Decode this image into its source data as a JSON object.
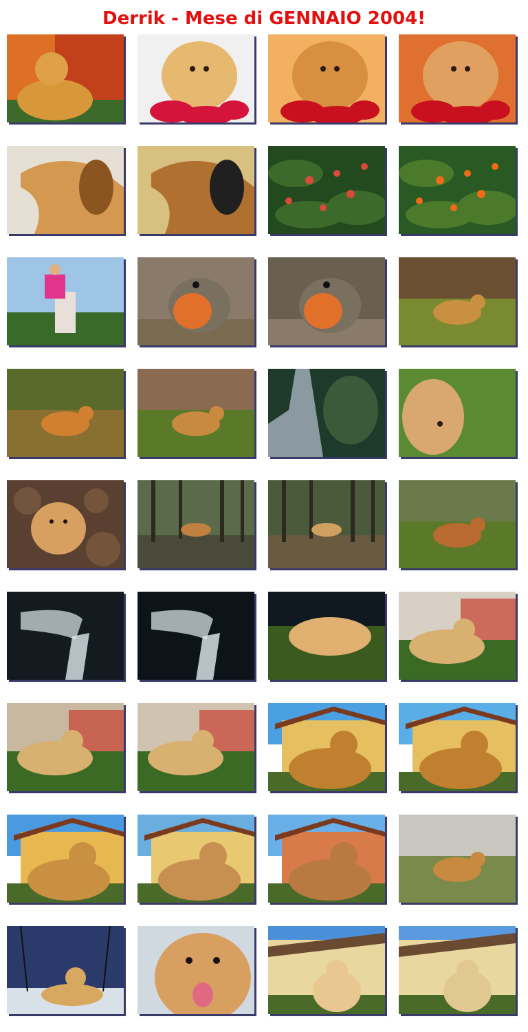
{
  "page": {
    "title": "Derrik - Mese di GENNAIO 2004!"
  },
  "thumbnails": [
    {
      "name": "dog-on-green-mat-photo",
      "scene": "dog-indoor",
      "c1": "#e8842a",
      "c2": "#c2401a",
      "c3": "#3c6a2a"
    },
    {
      "name": "dog-with-poinsettia-photo",
      "scene": "dog-flowers-light",
      "c1": "#f0f0f0",
      "c2": "#e6b870",
      "c3": "#d4143a"
    },
    {
      "name": "dog-sniffing-poinsettia-photo",
      "scene": "dog-flowers",
      "c1": "#f2b060",
      "c2": "#d89040",
      "c3": "#c8101e"
    },
    {
      "name": "dog-behind-poinsettia-pot-photo",
      "scene": "dog-flowers",
      "c1": "#e07030",
      "c2": "#e0a060",
      "c3": "#c8101e"
    },
    {
      "name": "dog-profile-closeup-photo",
      "scene": "dog-profile",
      "c1": "#e6e0d4",
      "c2": "#d49850",
      "c3": "#8a5520"
    },
    {
      "name": "dog-being-fed-photo",
      "scene": "dog-profile",
      "c1": "#d8c080",
      "c2": "#b07030",
      "c3": "#202020"
    },
    {
      "name": "berry-bush-photo",
      "scene": "berries",
      "c1": "#234a1e",
      "c2": "#3c6a2a",
      "c3": "#d84a3a"
    },
    {
      "name": "orange-berries-photo",
      "scene": "berries",
      "c1": "#2a5a24",
      "c2": "#4a7a2a",
      "c3": "#f06a1a"
    },
    {
      "name": "person-on-stone-bench-photo",
      "scene": "person",
      "c1": "#9ec4e6",
      "c2": "#3a6a2a",
      "c3": "#e2348a"
    },
    {
      "name": "robin-on-leaves-photo",
      "scene": "bird",
      "c1": "#8a7a6a",
      "c2": "#7a6a50",
      "c3": "#e0702a"
    },
    {
      "name": "robin-near-tree-photo",
      "scene": "bird",
      "c1": "#6a6050",
      "c2": "#8a7a6a",
      "c3": "#e0702a"
    },
    {
      "name": "dog-running-far-photo",
      "scene": "dog-field",
      "c1": "#6a5030",
      "c2": "#7a8a30",
      "c3": "#c89040"
    },
    {
      "name": "dog-running-sunset-photo",
      "scene": "dog-field",
      "c1": "#5a6a2a",
      "c2": "#8a7030",
      "c3": "#d08030"
    },
    {
      "name": "dog-running-toward-camera-photo",
      "scene": "dog-field",
      "c1": "#8a6a50",
      "c2": "#5a7a2a",
      "c3": "#c88a40"
    },
    {
      "name": "pine-branches-photo",
      "scene": "trees",
      "c1": "#1e3a2a",
      "c2": "#3a5a3a",
      "c3": "#8a9aa0"
    },
    {
      "name": "dog-running-blur-photo",
      "scene": "dog-blur",
      "c1": "#4a7a2a",
      "c2": "#6a9a3a",
      "c3": "#d8a870"
    },
    {
      "name": "dog-lying-in-leaves-photo",
      "scene": "dog-leaves",
      "c1": "#5a4030",
      "c2": "#7a5a40",
      "c3": "#d8a060"
    },
    {
      "name": "woods-with-dogs-photo",
      "scene": "woods",
      "c1": "#5a6a4a",
      "c2": "#4a4a3a",
      "c3": "#c08040"
    },
    {
      "name": "dog-standing-by-fence-photo",
      "scene": "woods",
      "c1": "#4a5a3a",
      "c2": "#6a5a40",
      "c3": "#d0a060"
    },
    {
      "name": "dog-with-toy-on-grass-photo",
      "scene": "dog-field",
      "c1": "#6a7a4a",
      "c2": "#5a7a2a",
      "c3": "#b86a30"
    },
    {
      "name": "knee-xray-1-photo",
      "scene": "xray",
      "c1": "#0a1218",
      "c2": "#202a30",
      "c3": "#dfe8ee"
    },
    {
      "name": "knee-xray-2-photo",
      "scene": "xray",
      "c1": "#050a10",
      "c2": "#1a2228",
      "c3": "#e4ecf0"
    },
    {
      "name": "dog-asleep-on-grass-photo",
      "scene": "dog-sleep",
      "c1": "#101820",
      "c2": "#3a5a1e",
      "c3": "#e0b070"
    },
    {
      "name": "dog-resting-in-garden-photo",
      "scene": "dog-house",
      "c1": "#d8d0c4",
      "c2": "#3a6a24",
      "c3": "#d8b070"
    },
    {
      "name": "dog-lying-by-house-1-photo",
      "scene": "dog-house",
      "c1": "#c8b8a0",
      "c2": "#3a6a24",
      "c3": "#d8b070"
    },
    {
      "name": "dog-lying-by-house-2-photo",
      "scene": "dog-house",
      "c1": "#d0c4b0",
      "c2": "#3a6a24",
      "c3": "#d8b070"
    },
    {
      "name": "dog-by-yellow-house-1-photo",
      "scene": "dog-yellow-house",
      "c1": "#4aa0e0",
      "c2": "#e6c060",
      "c3": "#c08030"
    },
    {
      "name": "dog-by-yellow-house-2-photo",
      "scene": "dog-yellow-house",
      "c1": "#5aaee8",
      "c2": "#e6c060",
      "c3": "#c08030"
    },
    {
      "name": "dog-portrait-yellow-house-photo",
      "scene": "dog-yellow-house",
      "c1": "#4a9ae0",
      "c2": "#e8b850",
      "c3": "#c89040"
    },
    {
      "name": "dog-lying-with-stick-photo",
      "scene": "dog-yellow-house",
      "c1": "#6aaee0",
      "c2": "#e8c870",
      "c3": "#c89050"
    },
    {
      "name": "dog-chewing-stick-photo",
      "scene": "dog-yellow-house",
      "c1": "#6ab0e8",
      "c2": "#d87a4a",
      "c3": "#b87a40"
    },
    {
      "name": "dog-lying-in-meadow-photo",
      "scene": "dog-field",
      "c1": "#c8c8c0",
      "c2": "#7a8a4a",
      "c3": "#c88a40"
    },
    {
      "name": "dog-under-bare-trees-photo",
      "scene": "dog-snow",
      "c1": "#2a3a6a",
      "c2": "#d8e0e8",
      "c3": "#d8a860"
    },
    {
      "name": "dog-face-closeup-photo",
      "scene": "dog-face",
      "c1": "#d0d8e0",
      "c2": "#d8a060",
      "c3": "#e06880"
    },
    {
      "name": "dog-by-porch-1-photo",
      "scene": "dog-porch",
      "c1": "#4a90d8",
      "c2": "#e8d8a0",
      "c3": "#e8c890"
    },
    {
      "name": "dog-by-porch-2-photo",
      "scene": "dog-porch",
      "c1": "#5a9ae0",
      "c2": "#e8d8a0",
      "c3": "#e0c890"
    }
  ]
}
